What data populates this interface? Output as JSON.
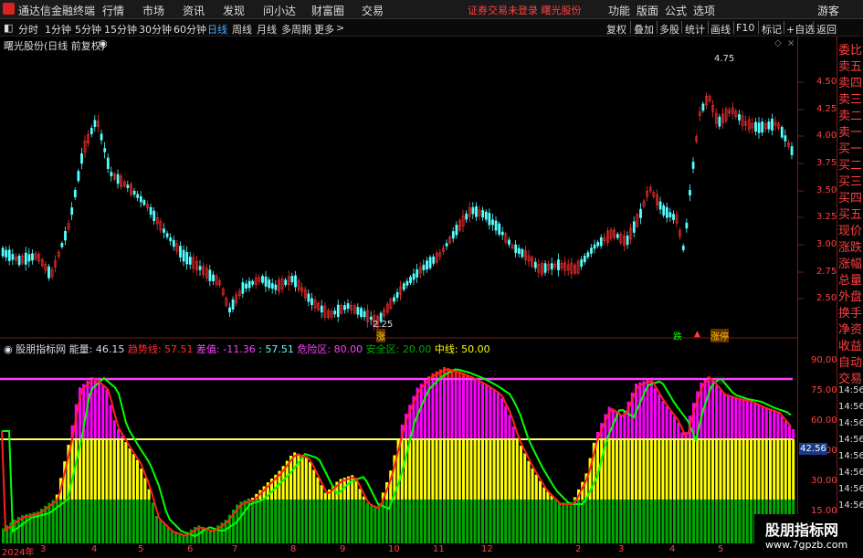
{
  "app": {
    "title": "通达信金融终端"
  },
  "menu": [
    "行情",
    "市场",
    "资讯",
    "发现",
    "问小达",
    "财富圈",
    "交易"
  ],
  "notice": "证券交易未登录  曙光股份",
  "right_menu": [
    "功能",
    "版面",
    "公式",
    "选项",
    "游客"
  ],
  "periods": [
    "分时",
    "1分钟",
    "5分钟",
    "15分钟",
    "30分钟",
    "60分钟",
    "日线",
    "周线",
    "月线",
    "多周期",
    "更多"
  ],
  "active_period": "日线",
  "tools": [
    "复权",
    "叠加",
    "多股",
    "统计",
    "画线",
    "F10",
    "标记",
    "+自选",
    "返回"
  ],
  "main_chart": {
    "title": "曙光股份(日线 前复权)",
    "high_label": "4.75",
    "low_label": "2.25",
    "y_ticks": [
      "4.50",
      "4.25",
      "4.00",
      "3.75",
      "3.50",
      "3.25",
      "3.00",
      "2.75",
      "2.50"
    ],
    "event_marks": [
      "涨",
      "跌",
      "涨停"
    ]
  },
  "indicator": {
    "name": "股朋指标网",
    "energy_label": "能量:",
    "energy": "46.15",
    "trend_label": "趋势线:",
    "trend": "57.51",
    "diff_label": "差值:",
    "diff": "-11.36",
    "extra": ": 57.51",
    "danger_label": "危险区:",
    "danger": "80.00",
    "safe_label": "安全区:",
    "safe": "20.00",
    "mid_label": "中线:",
    "mid": "50.00",
    "y_ticks": [
      "90.00",
      "75.00",
      "60.00",
      "45.00",
      "30.00",
      "15.00"
    ],
    "current_badge": "42.56"
  },
  "side_panel": [
    "委比",
    "卖五",
    "卖四",
    "卖三",
    "卖二",
    "卖一",
    "买一",
    "买二",
    "买三",
    "买四",
    "买五",
    "现价",
    "涨跌",
    "涨幅",
    "总量",
    "外盘",
    "换手",
    "净资",
    "收益",
    "自动",
    "交易",
    "14:56",
    "14:56",
    "14:56",
    "14:56",
    "14:56",
    "14:56",
    "14:56",
    "14:56",
    "14:56"
  ],
  "x_axis": [
    "2024年",
    "3",
    "4",
    "5",
    "6",
    "7",
    "8",
    "9",
    "10",
    "11",
    "12",
    "2",
    "3",
    "4",
    "5"
  ],
  "watermark": {
    "name": "股朋指标网",
    "url": "www.7gpzb.com"
  },
  "colors": {
    "up": "#ff3030",
    "down": "#55ffff",
    "magenta": "#ff00ff",
    "yellow": "#ffff00",
    "green": "#00aa00",
    "trend": "#00ff00",
    "red_line": "#ff2020",
    "danger_line": "#ff40ff",
    "mid_line": "#ffff66"
  }
}
